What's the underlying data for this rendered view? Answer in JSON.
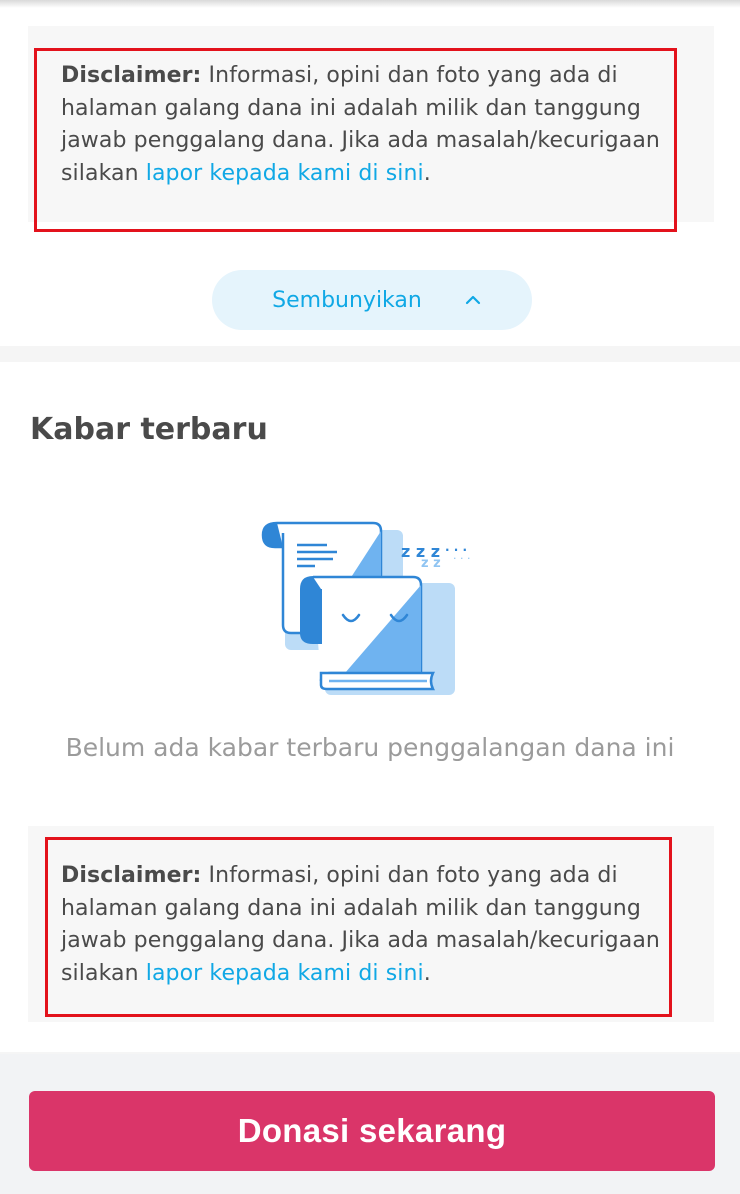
{
  "disclaimer_top": {
    "bold_label": "Disclaimer:",
    "text": " Informasi, opini dan foto yang ada di halaman galang dana ini adalah milik dan tanggung jawab penggalang dana. Jika ada masalah/kecurigaan silakan ",
    "link_text": "lapor kepada kami di sini",
    "end": "."
  },
  "collapse_button": {
    "label": "Sembunyikan",
    "icon": "chevron-up-icon"
  },
  "news": {
    "title": "Kabar terbaru",
    "empty_message": "Belum ada kabar terbaru penggalangan dana ini",
    "illustration": "sleeping-scrolls-illustration"
  },
  "disclaimer_bottom": {
    "bold_label": "Disclaimer:",
    "text": " Informasi, opini dan foto yang ada di halaman galang dana ini adalah milik dan tanggung jawab penggalang dana. Jika ada masalah/kecurigaan silakan ",
    "link_text": "lapor kepada kami di sini",
    "end": "."
  },
  "footer": {
    "donate_label": "Donasi sekarang"
  },
  "colors": {
    "accent_blue": "#10a8e5",
    "donate_pink": "#da3569",
    "highlight_red": "#e3121c"
  }
}
